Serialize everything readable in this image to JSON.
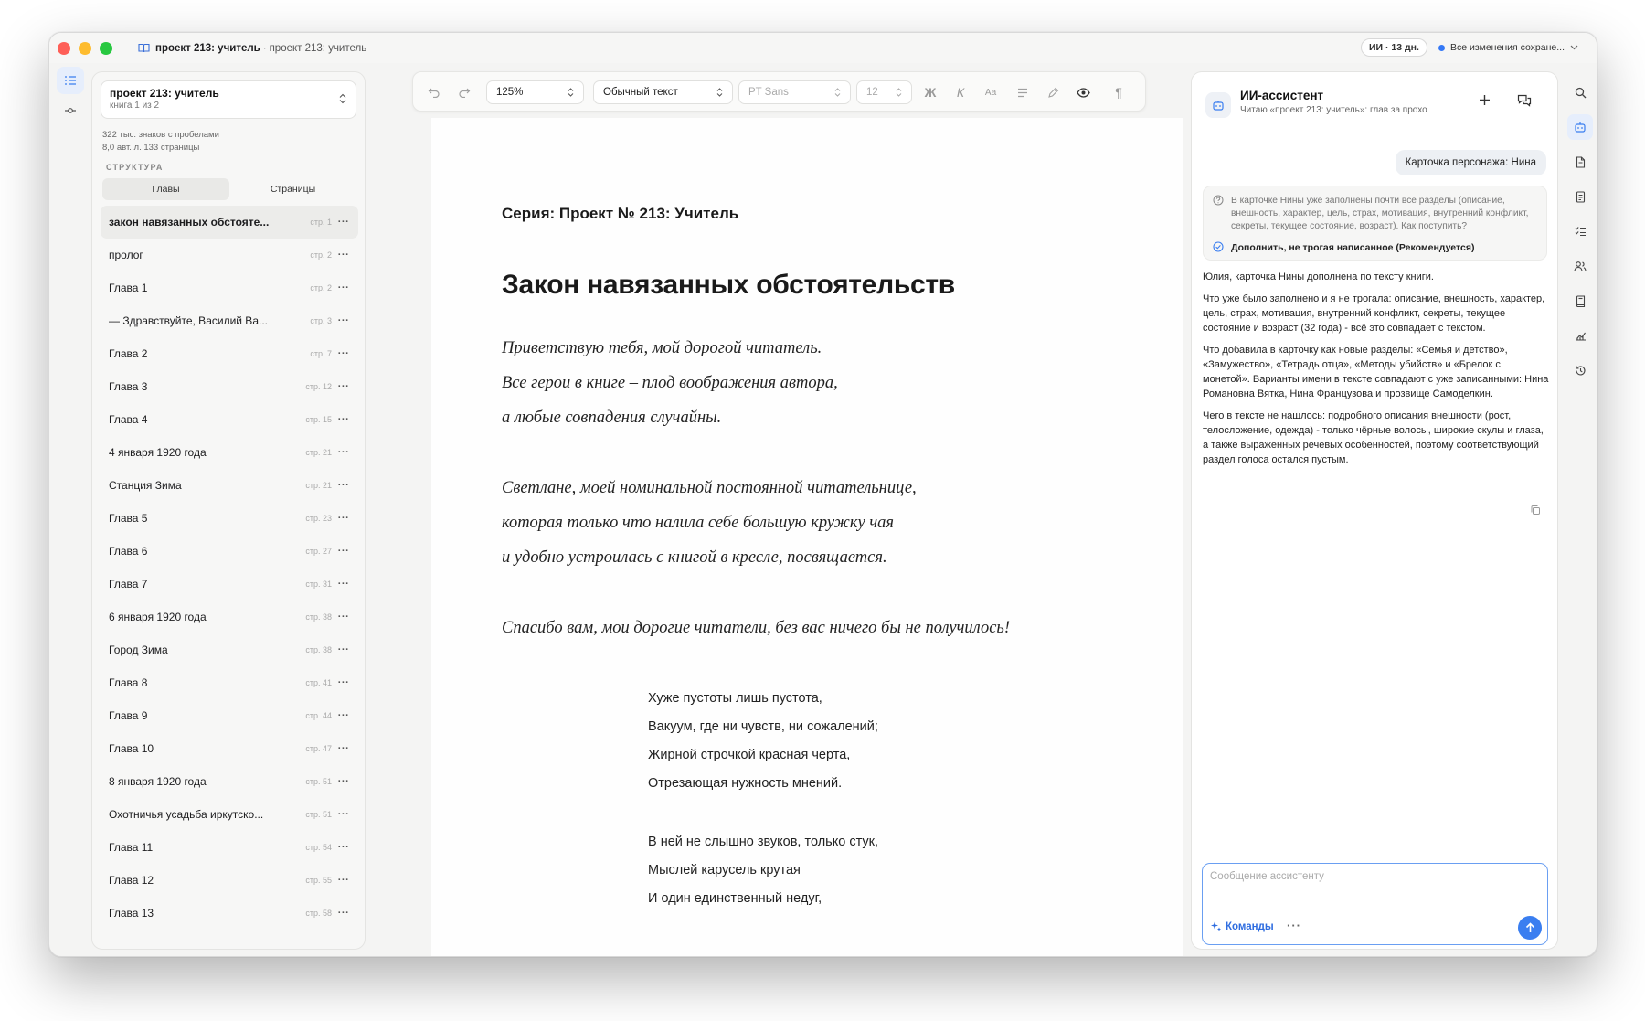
{
  "window": {
    "title_main": "проект 213: учитель",
    "title_separator": "·",
    "title_sub": "проект 213: учитель",
    "ai_days": "ИИ · 13 дн.",
    "save_status": "Все изменения сохране..."
  },
  "sidebar": {
    "project_name": "проект 213: учитель",
    "book_info": "книга 1 из 2",
    "stats_chars": "322 тыс. знаков с пробелами",
    "stats_pages": "8,0 авт. л.  133 страницы",
    "section_label": "СТРУКТУРА",
    "tab_chapters": "Главы",
    "tab_pages": "Страницы",
    "chapters": [
      {
        "title": "закон навязанных обстояте...",
        "page": "стр. 1"
      },
      {
        "title": "пролог",
        "page": "стр. 2"
      },
      {
        "title": "Глава 1",
        "page": "стр. 2"
      },
      {
        "title": "— Здравствуйте, Василий Ва...",
        "page": "стр. 3"
      },
      {
        "title": "Глава 2",
        "page": "стр. 7"
      },
      {
        "title": "Глава 3",
        "page": "стр. 12"
      },
      {
        "title": "Глава 4",
        "page": "стр. 15"
      },
      {
        "title": "4 января 1920 года",
        "page": "стр. 21"
      },
      {
        "title": "Станция Зима",
        "page": "стр. 21"
      },
      {
        "title": "Глава 5",
        "page": "стр. 23"
      },
      {
        "title": "Глава 6",
        "page": "стр. 27"
      },
      {
        "title": "Глава 7",
        "page": "стр. 31"
      },
      {
        "title": "6 января 1920 года",
        "page": "стр. 38"
      },
      {
        "title": "Город Зима",
        "page": "стр. 38"
      },
      {
        "title": "Глава 8",
        "page": "стр. 41"
      },
      {
        "title": "Глава 9",
        "page": "стр. 44"
      },
      {
        "title": "Глава 10",
        "page": "стр. 47"
      },
      {
        "title": "8 января 1920 года",
        "page": "стр. 51"
      },
      {
        "title": "Охотничья усадьба иркутско...",
        "page": "стр. 51"
      },
      {
        "title": "Глава 11",
        "page": "стр. 54"
      },
      {
        "title": "Глава 12",
        "page": "стр. 55"
      },
      {
        "title": "Глава 13",
        "page": "стр. 58"
      }
    ]
  },
  "toolbar": {
    "zoom": "125%",
    "style": "Обычный текст",
    "font": "PT Sans",
    "size": "12",
    "bold": "Ж",
    "italic": "К",
    "case": "Аа"
  },
  "document": {
    "series": "Серия: Проект № 213: Учитель",
    "title": "Закон навязанных обстоятельств",
    "italic_lines": [
      "Приветствую тебя, мой дорогой читатель.",
      "Все герои в книге – плод воображения автора,",
      "а любые совпадения случайны.",
      "Светлане, моей номинальной постоянной читательнице,",
      "которая только что налила себе большую кружку чая",
      "и удобно устроилась с книгой в кресле, посвящается.",
      "Спасибо вам, мои дорогие читатели, без вас ничего бы не получилось!"
    ],
    "poem_lines": [
      "Хуже пустоты лишь пустота,",
      "Вакуум, где ни чувств, ни сожалений;",
      "Жирной строчкой красная черта,",
      "Отрезающая нужность мнений.",
      "В ней не слышно звуков, только стук,",
      "Мыслей карусель крутая",
      "И один единственный недуг,"
    ]
  },
  "assistant": {
    "title": "ИИ-ассистент",
    "subtitle": "Читаю «проект 213: учитель»: глав за прохо",
    "user_message": "Карточка персонажа: Нина",
    "question": "В карточке Нины уже заполнены почти все разделы (описание, внешность, характер, цель, страх, мотивация, внутренний конфликт, секреты, текущее состояние, возраст). Как поступить?",
    "option": "Дополнить, не трогая написанное (Рекомендуется)",
    "reply": [
      "Юлия, карточка Нины дополнена по тексту книги.",
      "Что уже было заполнено и я не трогала: описание, внешность, характер, цель, страх, мотивация, внутренний конфликт, секреты, текущее состояние и возраст (32 года) - всё это совпадает с текстом.",
      "Что добавила в карточку как новые разделы: «Семья и детство», «Замужество», «Тетрадь отца», «Методы убийств» и «Брелок с монетой». Варианты имени в тексте совпадают с уже записанными: Нина Романовна Вятка, Нина Французова и прозвище Самоделкин.",
      "Чего в тексте не нашлось: подробного описания внешности (рост, телосложение, одежда) - только чёрные волосы, широкие скулы и глаза, а также выраженных речевых особенностей, поэтому соответствующий раздел голоса остался пустым."
    ],
    "input_placeholder": "Сообщение ассистенту",
    "commands": "Команды",
    "more": "···"
  },
  "colors": {
    "accent": "#3a7ef0",
    "traffic_red": "#fe5f57",
    "traffic_yellow": "#febc2e",
    "traffic_green": "#28c840"
  }
}
